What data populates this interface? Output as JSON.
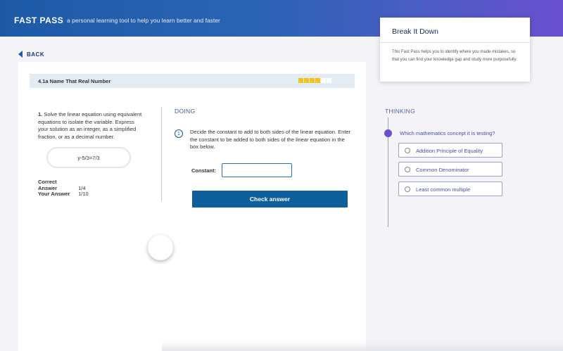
{
  "header": {
    "brand": "FAST PASS",
    "tagline": "a personal learning tool to help you learn better and faster"
  },
  "nav": {
    "back_label": "BACK"
  },
  "lesson": {
    "title": "4.1a Name That Real Number",
    "progress_segments": [
      "#f2c318",
      "#f2c318",
      "#f2c318",
      "#f2c318",
      "#ffffff",
      "#ffffff"
    ]
  },
  "problem": {
    "number": "1.",
    "text": "Solve the linear equation using equivalent equations to isolate the variable. Express your solution as an integer, as a simplified fraction, or as a decimal number.",
    "expression": "y-5/3=7/3",
    "correct_label": "Correct Answer",
    "correct_value": "1/4",
    "your_label": "Your Answer",
    "your_value": "1/10"
  },
  "doing": {
    "heading": "DOING",
    "step_number": "1",
    "instruction": "Decide the constant to add to both sides of the linear equation. Enter the constant to be added to both sides of the linear equation in the box below.",
    "constant_label": "Constant:",
    "constant_value": "",
    "check_button": "Check answer"
  },
  "help": {
    "title": "Break It Down",
    "body": "This Fast Pass helps you to identify where you made mistakes, so that you can find your knowledge gap and study more purposefully."
  },
  "thinking": {
    "heading": "THINKING",
    "question": "Which mathematics concept it is testing?",
    "options": [
      "Addition Principle of Equality",
      "Common Denominator",
      "Least common multiple"
    ]
  },
  "colors": {
    "accent_blue": "#0f5f9c",
    "accent_purple": "#6a4fc9",
    "progress_filled": "#f2c318"
  }
}
